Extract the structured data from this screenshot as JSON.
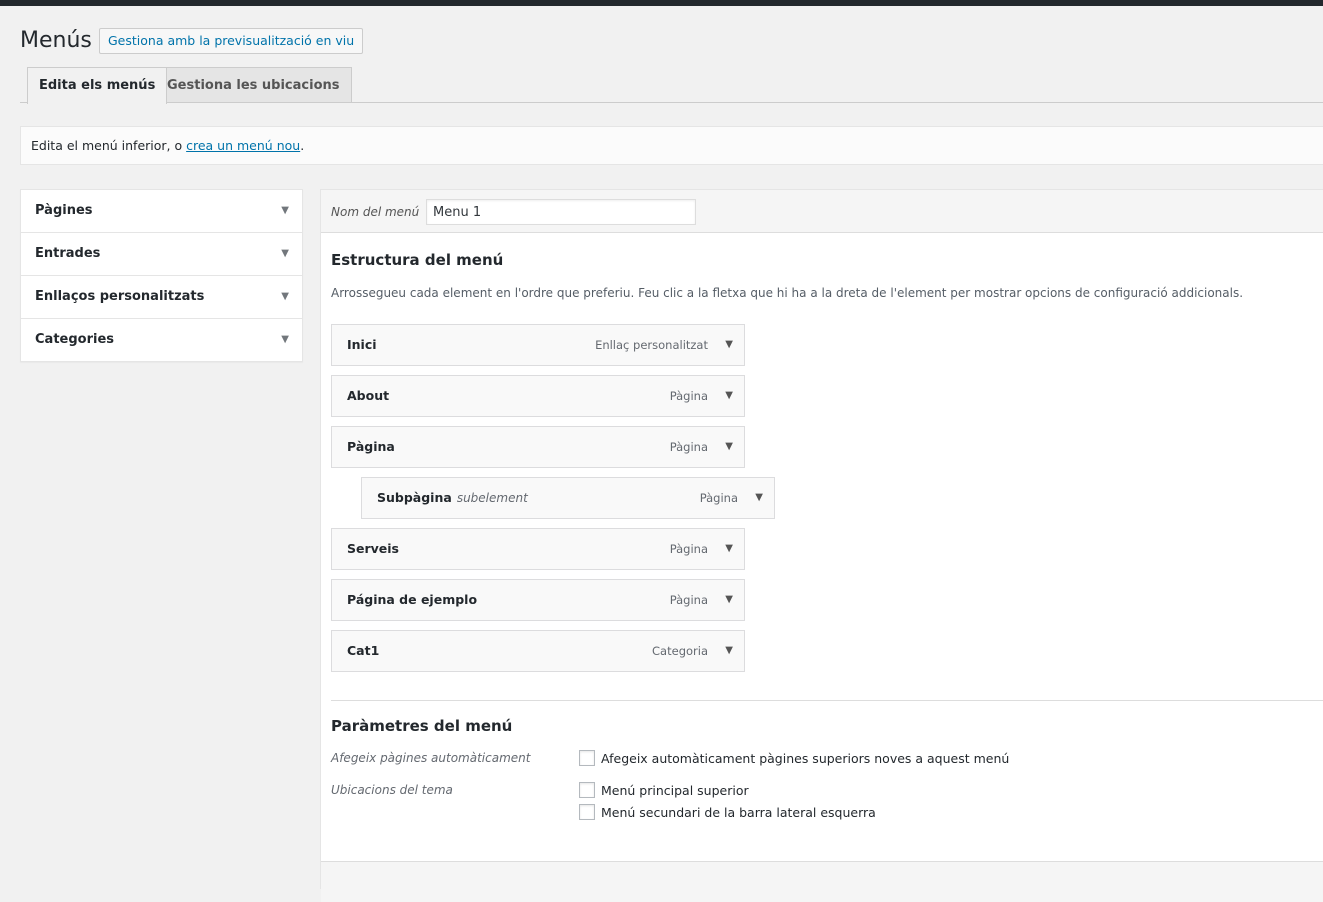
{
  "page": {
    "title": "Menús",
    "live_preview_button": "Gestiona amb la previsualització en viu"
  },
  "tabs": [
    {
      "label": "Edita els menús",
      "active": true
    },
    {
      "label": "Gestiona les ubicacions",
      "active": false
    }
  ],
  "notice": {
    "text_before": "Edita el menú inferior, o ",
    "link": "crea un menú nou",
    "text_after": "."
  },
  "sidebar": {
    "items": [
      {
        "label": "Pàgines",
        "icon": "arrow-down-icon"
      },
      {
        "label": "Entrades",
        "icon": "arrow-down-icon"
      },
      {
        "label": "Enllaços personalitzats",
        "icon": "arrow-down-icon"
      },
      {
        "label": "Categories",
        "icon": "arrow-down-icon"
      }
    ]
  },
  "menu": {
    "name_label": "Nom del menú",
    "name_value": "Menu 1",
    "structure_title": "Estructura del menú",
    "structure_desc": "Arrossegueu cada element en l'ordre que preferiu. Feu clic a la fletxa que hi ha a la dreta de l'element per mostrar opcions de configuració addicionals.",
    "items": [
      {
        "title": "Inici",
        "sub": "",
        "type": "Enllaç personalitzat"
      },
      {
        "title": "About",
        "sub": "",
        "type": "Pàgina"
      },
      {
        "title": "Pàgina",
        "sub": "",
        "type": "Pàgina"
      },
      {
        "title": "Subpàgina",
        "sub": "subelement",
        "type": "Pàgina"
      },
      {
        "title": "Serveis",
        "sub": "",
        "type": "Pàgina"
      },
      {
        "title": "Página de ejemplo",
        "sub": "",
        "type": "Pàgina"
      },
      {
        "title": "Cat1",
        "sub": "",
        "type": "Categoria"
      }
    ]
  },
  "settings": {
    "title": "Paràmetres del menú",
    "auto_add_label": "Afegeix pàgines automàticament",
    "auto_add_option": "Afegeix automàticament pàgines superiors noves a aquest menú",
    "locations_label": "Ubicacions del tema",
    "locations": [
      "Menú principal superior",
      "Menú secundari de la barra lateral esquerra"
    ]
  },
  "colors": {
    "accent": "#0073aa",
    "background": "#f1f1f1",
    "admin_bar": "#23282d"
  }
}
